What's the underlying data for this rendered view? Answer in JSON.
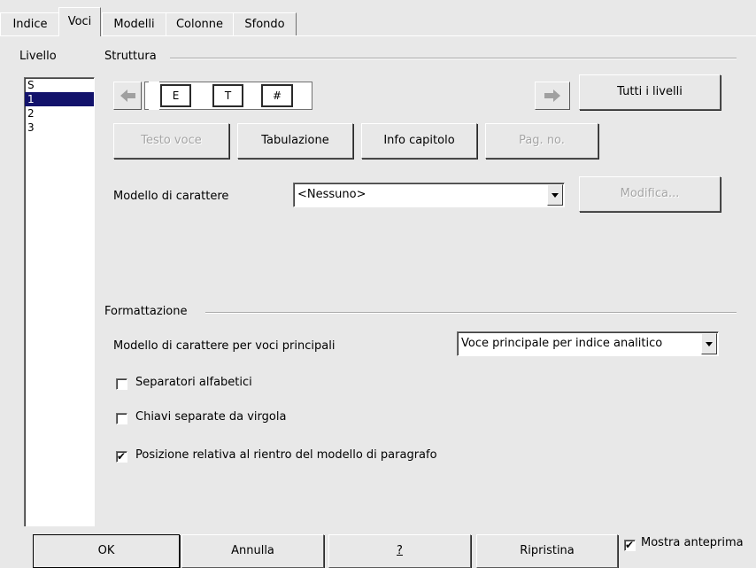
{
  "tabs": [
    "Indice",
    "Voci",
    "Modelli",
    "Colonne",
    "Sfondo"
  ],
  "level_group": {
    "title": "Livello",
    "items": [
      "S",
      "1",
      "2",
      "3"
    ],
    "selected_index": 1
  },
  "structure": {
    "title": "Struttura",
    "tokens": [
      "E",
      "T",
      "#"
    ],
    "left_arrow_icon": "arrow-left-icon",
    "right_arrow_icon": "arrow-right-icon",
    "all_levels_label": "Tutti i livelli",
    "buttons": {
      "entry_text": "Testo voce",
      "tab_stop": "Tabulazione",
      "chapter_info": "Info capitolo",
      "page_no": "Pag. no."
    },
    "char_style_label": "Modello di carattere",
    "char_style_value": "<Nessuno>",
    "edit_label": "Modifica..."
  },
  "format": {
    "title": "Formattazione",
    "main_entry_style_label": "Modello di carattere per voci principali",
    "main_entry_style_value": "Voce principale per indice analitico",
    "alpha_delim_label": "Separatori alfabetici",
    "alpha_delim_checked": false,
    "comma_keys_label": "Chiavi separate da virgola",
    "comma_keys_checked": false,
    "relative_pos_label": "Posizione relativa al rientro del modello di paragrafo",
    "relative_pos_checked": true
  },
  "footer": {
    "ok": "OK",
    "cancel": "Annulla",
    "help": "?",
    "reset": "Ripristina",
    "preview_label": "Mostra anteprima",
    "preview_checked": true
  },
  "colors": {
    "selection": "#12126b",
    "background": "#e8e8e8"
  }
}
